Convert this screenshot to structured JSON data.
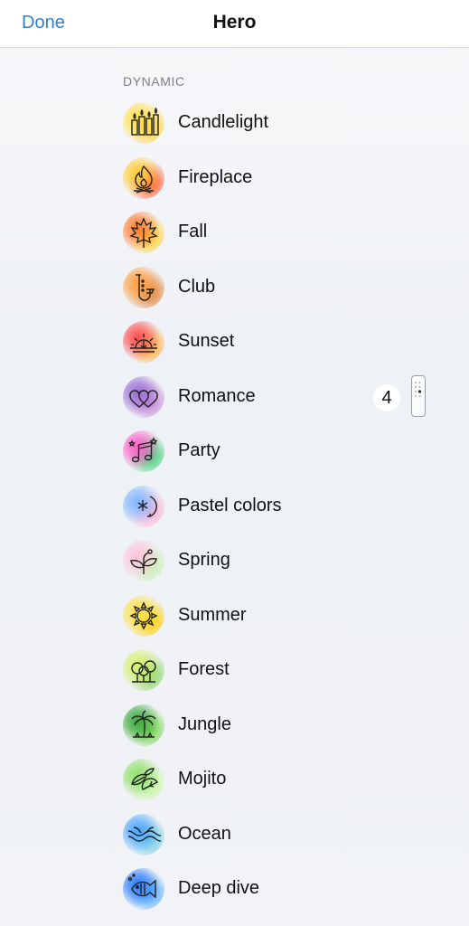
{
  "nav": {
    "done_label": "Done",
    "title": "Hero"
  },
  "section": {
    "header": "DYNAMIC"
  },
  "scenes": [
    {
      "label": "Candlelight",
      "icon": "candles-icon",
      "glow": [
        "#ffe14d",
        "#ffd23a"
      ]
    },
    {
      "label": "Fireplace",
      "icon": "fire-icon",
      "glow": [
        "#ffcc33",
        "#ff5a2a"
      ]
    },
    {
      "label": "Fall",
      "icon": "maple-leaf-icon",
      "glow": [
        "#ff7a2e",
        "#ffd23a"
      ]
    },
    {
      "label": "Club",
      "icon": "saxophone-icon",
      "glow": [
        "#ff9f43",
        "#e0853a"
      ]
    },
    {
      "label": "Sunset",
      "icon": "sunset-icon",
      "glow": [
        "#ff4d4d",
        "#ffb347"
      ]
    },
    {
      "label": "Romance",
      "icon": "hearts-icon",
      "glow": [
        "#9b6bd6",
        "#c88cd8"
      ]
    },
    {
      "label": "Party",
      "icon": "music-notes-icon",
      "glow": [
        "#ff5cc8",
        "#44d37a"
      ]
    },
    {
      "label": "Pastel colors",
      "icon": "pastel-sparkle-icon",
      "glow": [
        "#7fb6ff",
        "#ffb3d9"
      ]
    },
    {
      "label": "Spring",
      "icon": "sprout-icon",
      "glow": [
        "#ffc4dc",
        "#c8f0b4"
      ]
    },
    {
      "label": "Summer",
      "icon": "sun-icon",
      "glow": [
        "#ffe14d",
        "#ffd000"
      ]
    },
    {
      "label": "Forest",
      "icon": "trees-icon",
      "glow": [
        "#d5f26b",
        "#8ed66a"
      ]
    },
    {
      "label": "Jungle",
      "icon": "palm-tree-icon",
      "glow": [
        "#3aa83a",
        "#7ed957"
      ]
    },
    {
      "label": "Mojito",
      "icon": "mint-lime-icon",
      "glow": [
        "#8fe06a",
        "#c9f7a6"
      ]
    },
    {
      "label": "Ocean",
      "icon": "waves-icon",
      "glow": [
        "#4da3ff",
        "#7ad0e6"
      ]
    },
    {
      "label": "Deep dive",
      "icon": "fish-icon",
      "glow": [
        "#2a7bff",
        "#5ab0ff"
      ]
    }
  ],
  "romance_extra": {
    "count": "4"
  },
  "colors": {
    "accent": "#2f7fd3",
    "section_text": "#7b7f86"
  }
}
